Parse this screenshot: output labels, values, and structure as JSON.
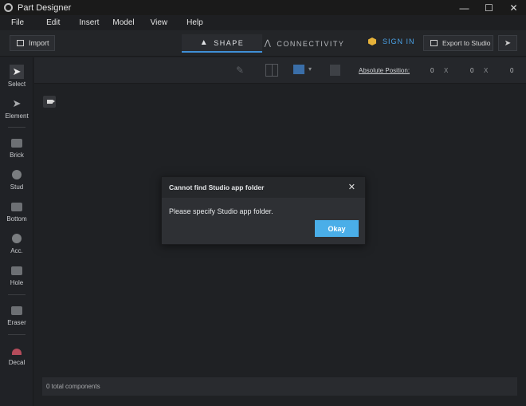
{
  "window": {
    "title": "Part Designer",
    "controls": {
      "minimize": "—",
      "maximize": "☐",
      "close": "✕"
    }
  },
  "menu": [
    "File",
    "Edit",
    "Insert",
    "Model",
    "View",
    "Help"
  ],
  "toolbar": {
    "import_label": "Import",
    "tabs": [
      {
        "label": "SHAPE",
        "active": true
      },
      {
        "label": "CONNECTIVITY",
        "active": false
      }
    ],
    "signin_label": "SIGN IN",
    "export_label": "Export to Studio"
  },
  "sidebar": {
    "tools": [
      {
        "label": "Select",
        "icon": "cursor-icon",
        "active": true
      },
      {
        "label": "Element",
        "icon": "element-cursor-icon"
      },
      {
        "label": "Brick",
        "icon": "brick-icon"
      },
      {
        "label": "Stud",
        "icon": "stud-icon"
      },
      {
        "label": "Bottom",
        "icon": "bottom-icon"
      },
      {
        "label": "Acc.",
        "icon": "accessory-icon"
      },
      {
        "label": "Hole",
        "icon": "hole-icon"
      },
      {
        "label": "Eraser",
        "icon": "eraser-icon"
      },
      {
        "label": "Decal",
        "icon": "decal-icon"
      }
    ]
  },
  "position": {
    "label": "Absolute Position:",
    "x": "0",
    "y": "0",
    "z": "0",
    "axis_labels": [
      "X",
      "X"
    ]
  },
  "status": {
    "components_text": "0 total components"
  },
  "dialog": {
    "title": "Cannot find Studio app folder",
    "message": "Please specify Studio app folder.",
    "ok_label": "Okay"
  },
  "colors": {
    "accent": "#4aaee8",
    "tab_underline": "#3f8fd6",
    "signin": "#4aa3e8"
  }
}
